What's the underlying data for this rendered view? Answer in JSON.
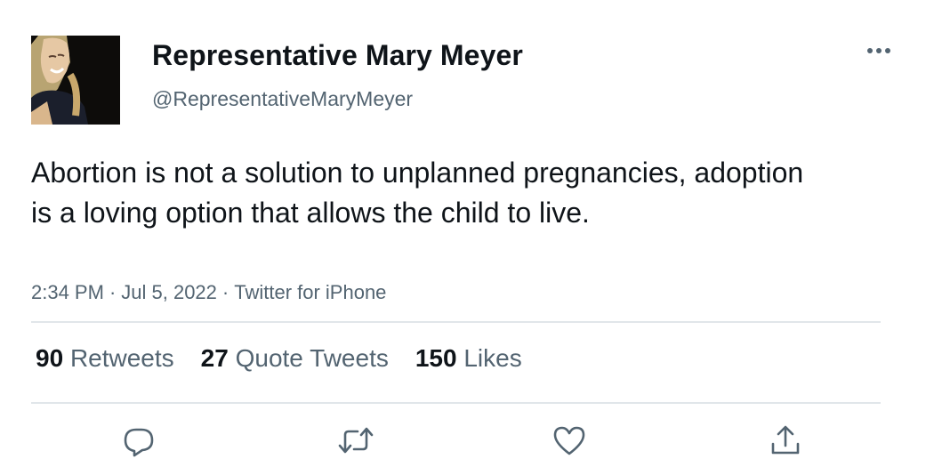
{
  "user": {
    "display_name": "Representative Mary Meyer",
    "handle": "@RepresentativeMaryMeyer"
  },
  "tweet": {
    "text": "Abortion is not a solution to unplanned pregnancies, adoption is a loving option that allows the child to live.",
    "time": "2:34 PM",
    "separator": "·",
    "date": "Jul 5, 2022",
    "source": "Twitter for iPhone"
  },
  "stats": {
    "retweets_count": "90",
    "retweets_label": "Retweets",
    "quotes_count": "27",
    "quotes_label": "Quote Tweets",
    "likes_count": "150",
    "likes_label": "Likes"
  },
  "icons": {
    "more": "more-horizontal-icon",
    "reply": "reply-icon",
    "retweet": "retweet-icon",
    "like": "heart-icon",
    "share": "share-icon"
  },
  "colors": {
    "text_primary": "#0f1419",
    "text_secondary": "#536471",
    "divider": "#e1e6ea"
  }
}
